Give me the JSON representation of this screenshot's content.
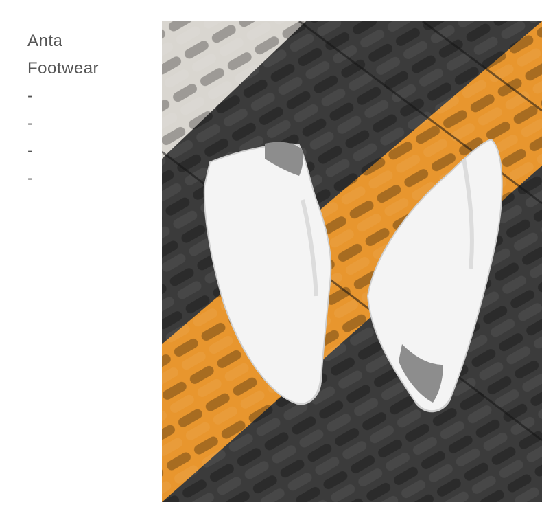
{
  "brand": {
    "name_line1": "Anta",
    "name_line2": "Footwear"
  },
  "list_markers": [
    "-",
    "-",
    "-",
    "-"
  ],
  "photo": {
    "subject": "pair of white low-top sneakers on tactile paving",
    "colors": {
      "dark_tile": "#3b3b3b",
      "orange_tile": "#e8962e",
      "concrete": "#d9d6d0",
      "shoe_white": "#f4f4f4",
      "shoe_grey_accent": "#8d8d8d"
    }
  }
}
